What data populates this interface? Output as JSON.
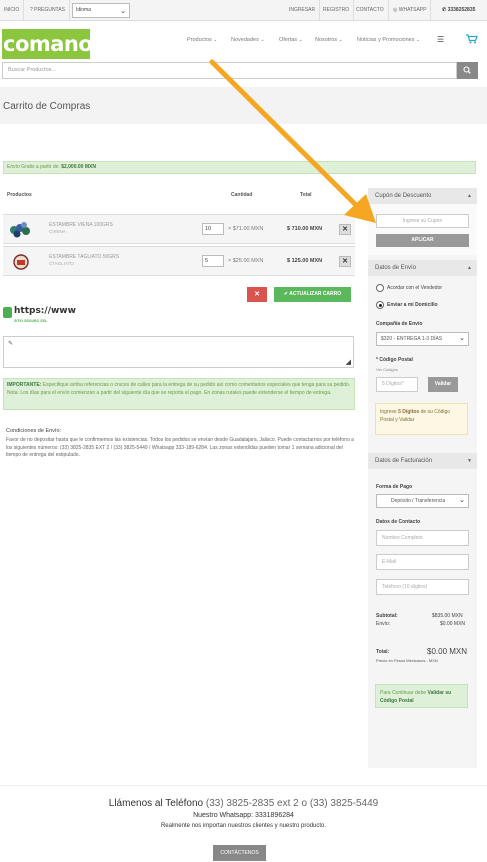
{
  "topbar": {
    "inicio": "INICIO",
    "preguntas": "? PREGUNTAS",
    "idioma": "Idioma",
    "ingresar": "INGRESAR",
    "registro": "REGISTRO",
    "contacto": "CONTACTO",
    "whatsapp": "WHATSAPP",
    "phone": "3338252835"
  },
  "header": {
    "logo": "comanov",
    "nav": [
      "Productos",
      "Novedades",
      "Ofertas",
      "Nosotros",
      "Noticias y Promociones"
    ]
  },
  "search": {
    "placeholder": "Buscar Productos..."
  },
  "page": {
    "title": "Carrito de Compras"
  },
  "notice": {
    "prefix": "Envío Gratis a partir de:",
    "amount": "$2,000.00 MXN"
  },
  "cart": {
    "headers": {
      "productos": "Productos",
      "cantidad": "Cantidad",
      "total": "Total"
    },
    "items": [
      {
        "name": "ESTAMBRE VIENA 100GRS",
        "code": "CVIENA",
        "qty": "10",
        "unit": "× $71.00 MXN",
        "total": "$ 710.00 MXN"
      },
      {
        "name": "ESTAMBRE TAGLIATO 50GRS",
        "code": "CTAGLIATO",
        "qty": "5",
        "unit": "× $25.00 MXN",
        "total": "$ 125.00 MXN"
      }
    ],
    "update_label": "ACTUALIZAR CARRO"
  },
  "ssl": {
    "url": "https://www",
    "sub": "SITIO SEGURO SSL"
  },
  "important": {
    "label": "IMPORTANTE:",
    "text": " Especifique arriba referencias o cruces de calles para la entrega de su pedido así como comentarios especiales que tenga para su pedido. Nota: Los días para el envío comienzan a partir del siguiente día que se reporta el pago. En zonas rurales puede extenderse el tiempo de entrega."
  },
  "conditions": {
    "title": "Condiciones de Envío:",
    "text": "Favor de no depositar hasta que le confirmemos las existencias. Todos los pedidos se envían desde Guadalajara, Jalisco. Puede contactarnos por teléfono a los siguientes números: (33) 3825-2835 EXT 2 / (33) 3825-5449 / Whatsapp 333-189-6284. Las zonas extendidas pueden tomar 1 semana adicional del tiempo de entrega del estipulado."
  },
  "coupon": {
    "header": "Cupón de Descuento",
    "placeholder": "Ingrese su Cupón",
    "apply": "APLICAR"
  },
  "shipping": {
    "header": "Datos de Envío",
    "option1": "Acordar con el Vendedor",
    "option2": "Enviar a mi Domicilio",
    "company_label": "Compañía de Envío",
    "company_value": "$320 - ENTREGA 1-3 DÍAS",
    "postal_label": "* Código Postal",
    "postal_hint": "Ver Códigos",
    "postal_placeholder": "5 Dígitos*",
    "validate": "Validar",
    "warn_prefix": "Ingrese ",
    "warn_bold": "5 Dígitos",
    "warn_suffix": " de su Código Postal y Validar"
  },
  "billing": {
    "header": "Datos de Facturación",
    "payment_label": "Forma de Pago",
    "payment_value": "Depósito / Transferencia",
    "contact_label": "Datos de Contacto",
    "name_placeholder": "Nombre Completo",
    "email_placeholder": "E-Mail",
    "phone_placeholder": "Teléfono (10 dígitos)"
  },
  "summary": {
    "subtotal_label": "Subtotal:",
    "subtotal_value": "$835.00 MXN",
    "envio_label": "Envío:",
    "envio_value": "$0.00 MXN",
    "total_label": "Total:",
    "total_value": "$0.00 MXN",
    "note": "Precio en Pesos Mexicanos - MXN",
    "continue_prefix": "Para Continuar debe ",
    "continue_bold": "Validar su Código Postal"
  },
  "footer": {
    "phone_label": "Llámenos al Teléfono",
    "phone_numbers": "(33) 3825-2835 ext 2 o (33) 3825-5449",
    "whatsapp": "Nuestro Whatsapp: 3331896284",
    "tagline": "Realmente nos importan nuestros clientes y nuestro producto.",
    "contact_btn": "CONTÁCTENOS"
  },
  "colors": {
    "brand": "#8cc63f",
    "annotation_arrow": "#f5a623"
  }
}
